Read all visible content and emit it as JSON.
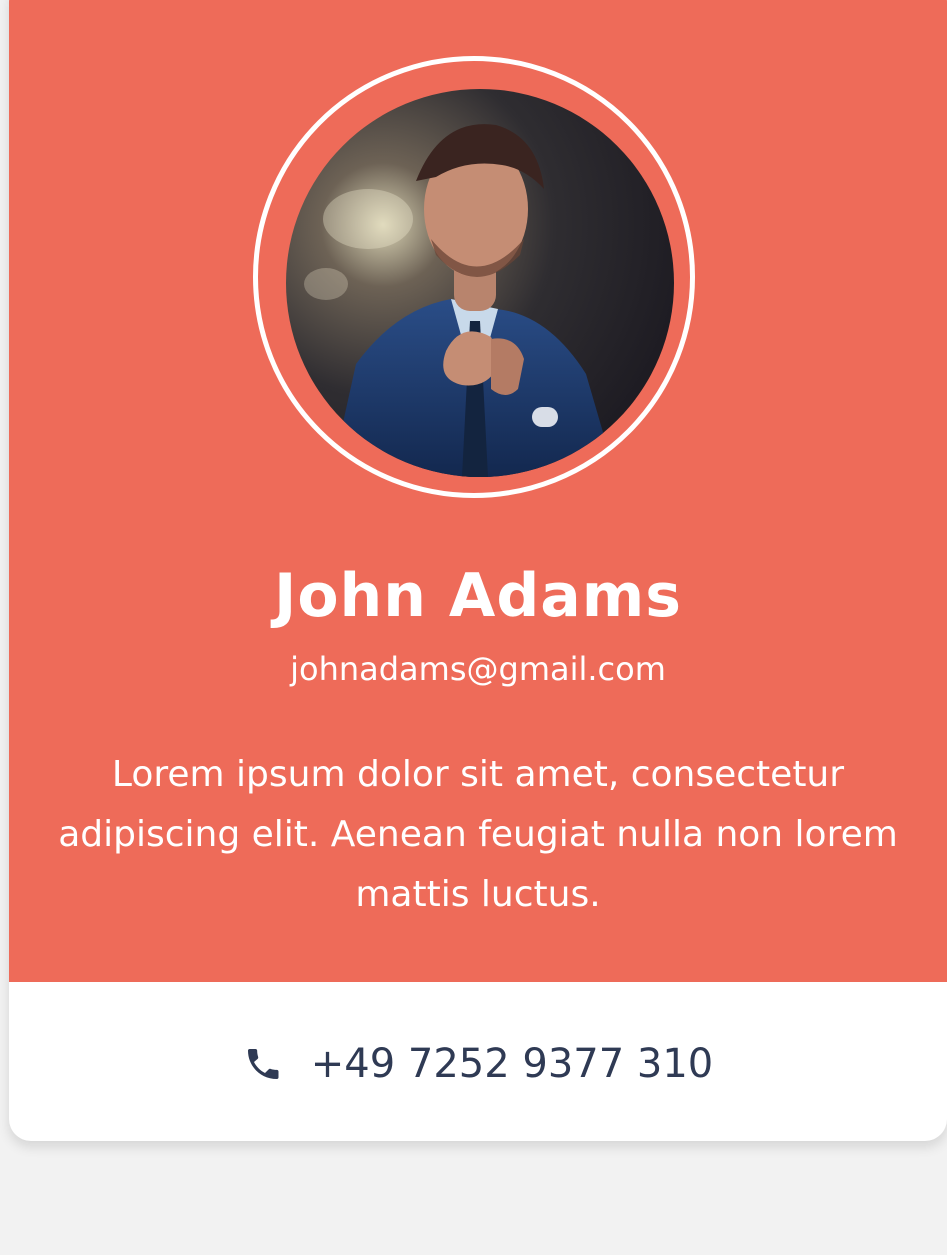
{
  "profile": {
    "name": "John Adams",
    "email": "johnadams@gmail.com",
    "bio": "Lorem ipsum dolor sit amet, consectetur adipiscing elit. Aenean feugiat nulla non lorem mattis luctus.",
    "phone": "+49 7252 9377 310",
    "avatar_icon": "profile-photo",
    "phone_icon": "phone-icon"
  },
  "colors": {
    "accent": "#ee6b59",
    "card_bottom": "#ffffff",
    "text_primary": "#ffffff",
    "text_contact": "#2f3a54",
    "page_background": "#f2f2f2"
  }
}
